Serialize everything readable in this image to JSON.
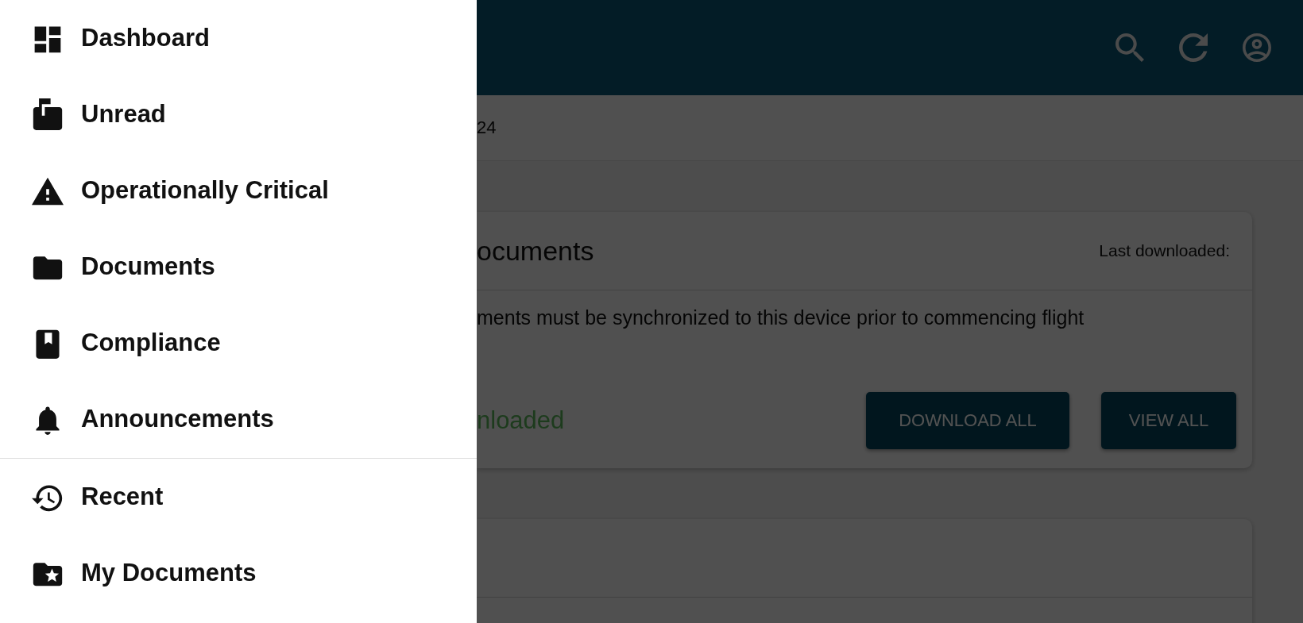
{
  "drawer": {
    "sections": [
      {
        "items": [
          {
            "label": "Dashboard"
          },
          {
            "label": "Unread"
          },
          {
            "label": "Operationally Critical"
          },
          {
            "label": "Documents"
          },
          {
            "label": "Compliance"
          },
          {
            "label": "Announcements"
          }
        ]
      },
      {
        "items": [
          {
            "label": "Recent"
          },
          {
            "label": "My Documents"
          }
        ]
      }
    ]
  },
  "breadcrumb": {
    "text": "24"
  },
  "card": {
    "title": "ocuments",
    "last_downloaded": "Last downloaded:",
    "message": "ments must be synchronized to this device prior to commencing flight",
    "status": "nloaded",
    "buttons": [
      "DOWNLOAD ALL",
      "VIEW ALL"
    ]
  }
}
